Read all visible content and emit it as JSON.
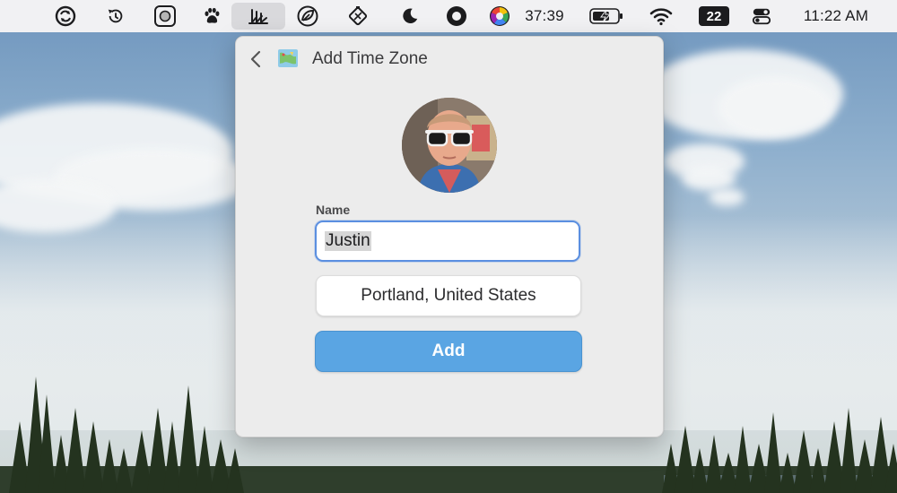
{
  "menubar": {
    "icons": [
      "sync-icon",
      "time-machine-icon",
      "screenshot-app-icon",
      "paw-icon",
      "timezone-app-icon",
      "leaf-icon",
      "vpn-icon",
      "moon-icon",
      "record-icon",
      "pie-timer-icon",
      "battery-icon",
      "wifi-icon",
      "calendar-icon",
      "control-center-icon"
    ],
    "timer": "37:39",
    "calendar_day": "22",
    "clock": "11:22 AM",
    "active_item": "timezone-app-icon"
  },
  "popover": {
    "title": "Add Time Zone",
    "name_label": "Name",
    "name_value": "Justin",
    "location_button": "Portland, United States",
    "add_button": "Add"
  },
  "colors": {
    "accent_blue": "#5aa5e3",
    "focus_ring": "#5b8fe0",
    "menubar_bg": "#f1f1f3",
    "popover_bg": "#ececec"
  }
}
